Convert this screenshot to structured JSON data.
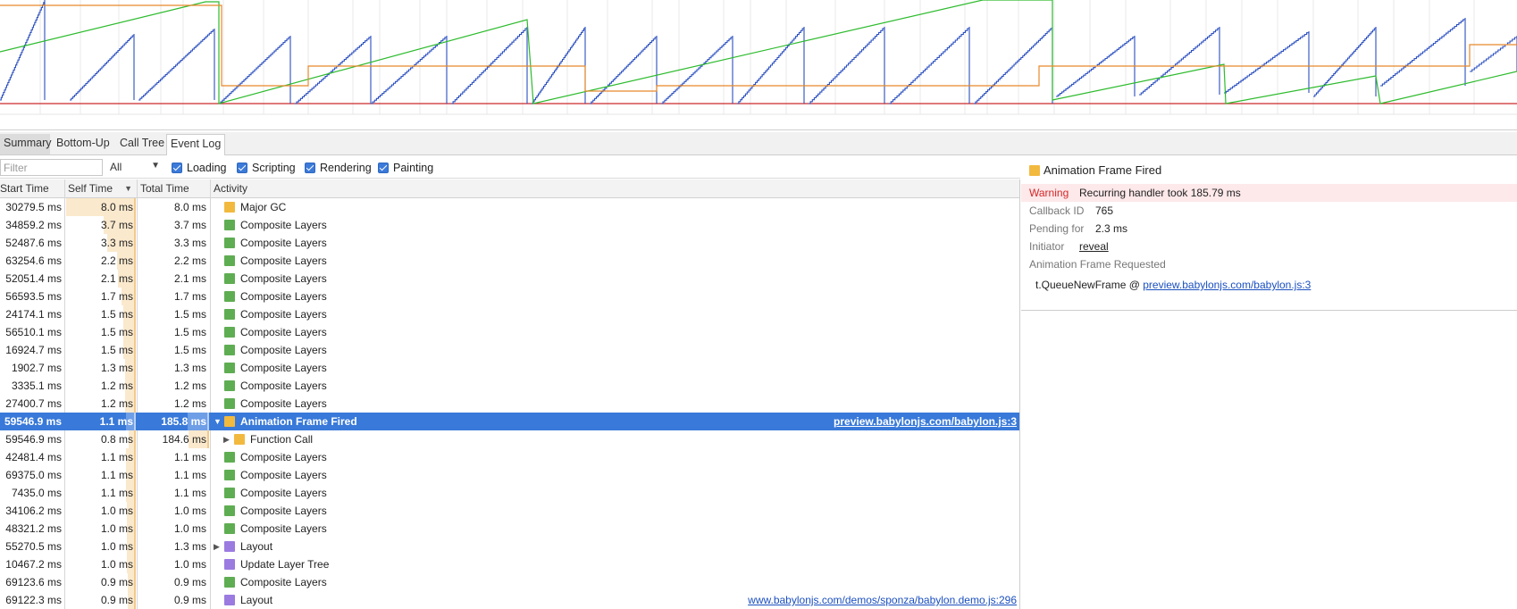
{
  "tabs": [
    {
      "label": "Summary"
    },
    {
      "label": "Bottom-Up"
    },
    {
      "label": "Call Tree"
    },
    {
      "label": "Event Log"
    }
  ],
  "filter": {
    "placeholder": "Filter",
    "level_value": "All",
    "checkboxes": [
      {
        "label": "Loading",
        "checked": true
      },
      {
        "label": "Scripting",
        "checked": true
      },
      {
        "label": "Rendering",
        "checked": true
      },
      {
        "label": "Painting",
        "checked": true
      }
    ]
  },
  "columns": {
    "start_time": "Start Time",
    "self_time": "Self Time",
    "total_time": "Total Time",
    "activity": "Activity",
    "sort_indicator": "▼"
  },
  "colors": {
    "scripting": "#f2b93f",
    "rendering": "#5fad52",
    "painting": "#9b7be0",
    "selection": "#3879d9",
    "warning_bg": "#fde8ea",
    "warning_text": "#d32828"
  },
  "rows": [
    {
      "start": "30279.5 ms",
      "self": "8.0 ms",
      "total": "8.0 ms",
      "activity": "Major GC",
      "category": "scripting",
      "self_frac": 1.0,
      "total_frac": 0.0,
      "expander": "",
      "indent": 0
    },
    {
      "start": "34859.2 ms",
      "self": "3.7 ms",
      "total": "3.7 ms",
      "activity": "Composite Layers",
      "category": "rendering",
      "self_frac": 0.46,
      "total_frac": 0.0,
      "expander": "",
      "indent": 0
    },
    {
      "start": "52487.6 ms",
      "self": "3.3 ms",
      "total": "3.3 ms",
      "activity": "Composite Layers",
      "category": "rendering",
      "self_frac": 0.41,
      "total_frac": 0.0,
      "expander": "",
      "indent": 0
    },
    {
      "start": "63254.6 ms",
      "self": "2.2 ms",
      "total": "2.2 ms",
      "activity": "Composite Layers",
      "category": "rendering",
      "self_frac": 0.27,
      "total_frac": 0.0,
      "expander": "",
      "indent": 0
    },
    {
      "start": "52051.4 ms",
      "self": "2.1 ms",
      "total": "2.1 ms",
      "activity": "Composite Layers",
      "category": "rendering",
      "self_frac": 0.26,
      "total_frac": 0.0,
      "expander": "",
      "indent": 0
    },
    {
      "start": "56593.5 ms",
      "self": "1.7 ms",
      "total": "1.7 ms",
      "activity": "Composite Layers",
      "category": "rendering",
      "self_frac": 0.2,
      "total_frac": 0.0,
      "expander": "",
      "indent": 0
    },
    {
      "start": "24174.1 ms",
      "self": "1.5 ms",
      "total": "1.5 ms",
      "activity": "Composite Layers",
      "category": "rendering",
      "self_frac": 0.18,
      "total_frac": 0.0,
      "expander": "",
      "indent": 0
    },
    {
      "start": "56510.1 ms",
      "self": "1.5 ms",
      "total": "1.5 ms",
      "activity": "Composite Layers",
      "category": "rendering",
      "self_frac": 0.18,
      "total_frac": 0.0,
      "expander": "",
      "indent": 0
    },
    {
      "start": "16924.7 ms",
      "self": "1.5 ms",
      "total": "1.5 ms",
      "activity": "Composite Layers",
      "category": "rendering",
      "self_frac": 0.18,
      "total_frac": 0.0,
      "expander": "",
      "indent": 0
    },
    {
      "start": "1902.7 ms",
      "self": "1.3 ms",
      "total": "1.3 ms",
      "activity": "Composite Layers",
      "category": "rendering",
      "self_frac": 0.16,
      "total_frac": 0.0,
      "expander": "",
      "indent": 0
    },
    {
      "start": "3335.1 ms",
      "self": "1.2 ms",
      "total": "1.2 ms",
      "activity": "Composite Layers",
      "category": "rendering",
      "self_frac": 0.15,
      "total_frac": 0.0,
      "expander": "",
      "indent": 0
    },
    {
      "start": "27400.7 ms",
      "self": "1.2 ms",
      "total": "1.2 ms",
      "activity": "Composite Layers",
      "category": "rendering",
      "self_frac": 0.15,
      "total_frac": 0.0,
      "expander": "",
      "indent": 0
    },
    {
      "start": "59546.9 ms",
      "self": "1.1 ms",
      "total": "185.8 ms",
      "activity": "Animation Frame Fired",
      "category": "scripting",
      "self_frac": 0.14,
      "total_frac": 0.3,
      "expander": "▼",
      "indent": 0,
      "selected": true,
      "link": "preview.babylonjs.com/babylon.js:3"
    },
    {
      "start": "59546.9 ms",
      "self": "0.8 ms",
      "total": "184.6 ms",
      "activity": "Function Call",
      "category": "scripting",
      "self_frac": 0.1,
      "total_frac": 0.29,
      "expander": "▶",
      "indent": 1
    },
    {
      "start": "42481.4 ms",
      "self": "1.1 ms",
      "total": "1.1 ms",
      "activity": "Composite Layers",
      "category": "rendering",
      "self_frac": 0.14,
      "total_frac": 0.0,
      "expander": "",
      "indent": 0
    },
    {
      "start": "69375.0 ms",
      "self": "1.1 ms",
      "total": "1.1 ms",
      "activity": "Composite Layers",
      "category": "rendering",
      "self_frac": 0.14,
      "total_frac": 0.0,
      "expander": "",
      "indent": 0
    },
    {
      "start": "7435.0 ms",
      "self": "1.1 ms",
      "total": "1.1 ms",
      "activity": "Composite Layers",
      "category": "rendering",
      "self_frac": 0.14,
      "total_frac": 0.0,
      "expander": "",
      "indent": 0
    },
    {
      "start": "34106.2 ms",
      "self": "1.0 ms",
      "total": "1.0 ms",
      "activity": "Composite Layers",
      "category": "rendering",
      "self_frac": 0.13,
      "total_frac": 0.0,
      "expander": "",
      "indent": 0
    },
    {
      "start": "48321.2 ms",
      "self": "1.0 ms",
      "total": "1.0 ms",
      "activity": "Composite Layers",
      "category": "rendering",
      "self_frac": 0.13,
      "total_frac": 0.0,
      "expander": "",
      "indent": 0
    },
    {
      "start": "55270.5 ms",
      "self": "1.0 ms",
      "total": "1.3 ms",
      "activity": "Layout",
      "category": "painting",
      "self_frac": 0.13,
      "total_frac": 0.0,
      "expander": "▶",
      "indent": 0
    },
    {
      "start": "10467.2 ms",
      "self": "1.0 ms",
      "total": "1.0 ms",
      "activity": "Update Layer Tree",
      "category": "painting",
      "self_frac": 0.13,
      "total_frac": 0.0,
      "expander": "",
      "indent": 0
    },
    {
      "start": "69123.6 ms",
      "self": "0.9 ms",
      "total": "0.9 ms",
      "activity": "Composite Layers",
      "category": "rendering",
      "self_frac": 0.11,
      "total_frac": 0.0,
      "expander": "",
      "indent": 0
    },
    {
      "start": "69122.3 ms",
      "self": "0.9 ms",
      "total": "0.9 ms",
      "activity": "Layout",
      "category": "painting",
      "self_frac": 0.11,
      "total_frac": 0.0,
      "expander": "",
      "indent": 0,
      "link": "www.babylonjs.com/demos/sponza/babylon.demo.js:296"
    }
  ],
  "details": {
    "title": "Animation Frame Fired",
    "warning_key": "Warning",
    "warning_value": "Recurring handler took 185.79 ms",
    "callback_key": "Callback ID",
    "callback_value": "765",
    "pending_key": "Pending for",
    "pending_value": "2.3 ms",
    "initiator_key": "Initiator",
    "initiator_value": "reveal",
    "requested_label": "Animation Frame Requested",
    "stack_function": "t.QueueNewFrame @ ",
    "stack_link": "preview.babylonjs.com/babylon.js:3"
  }
}
